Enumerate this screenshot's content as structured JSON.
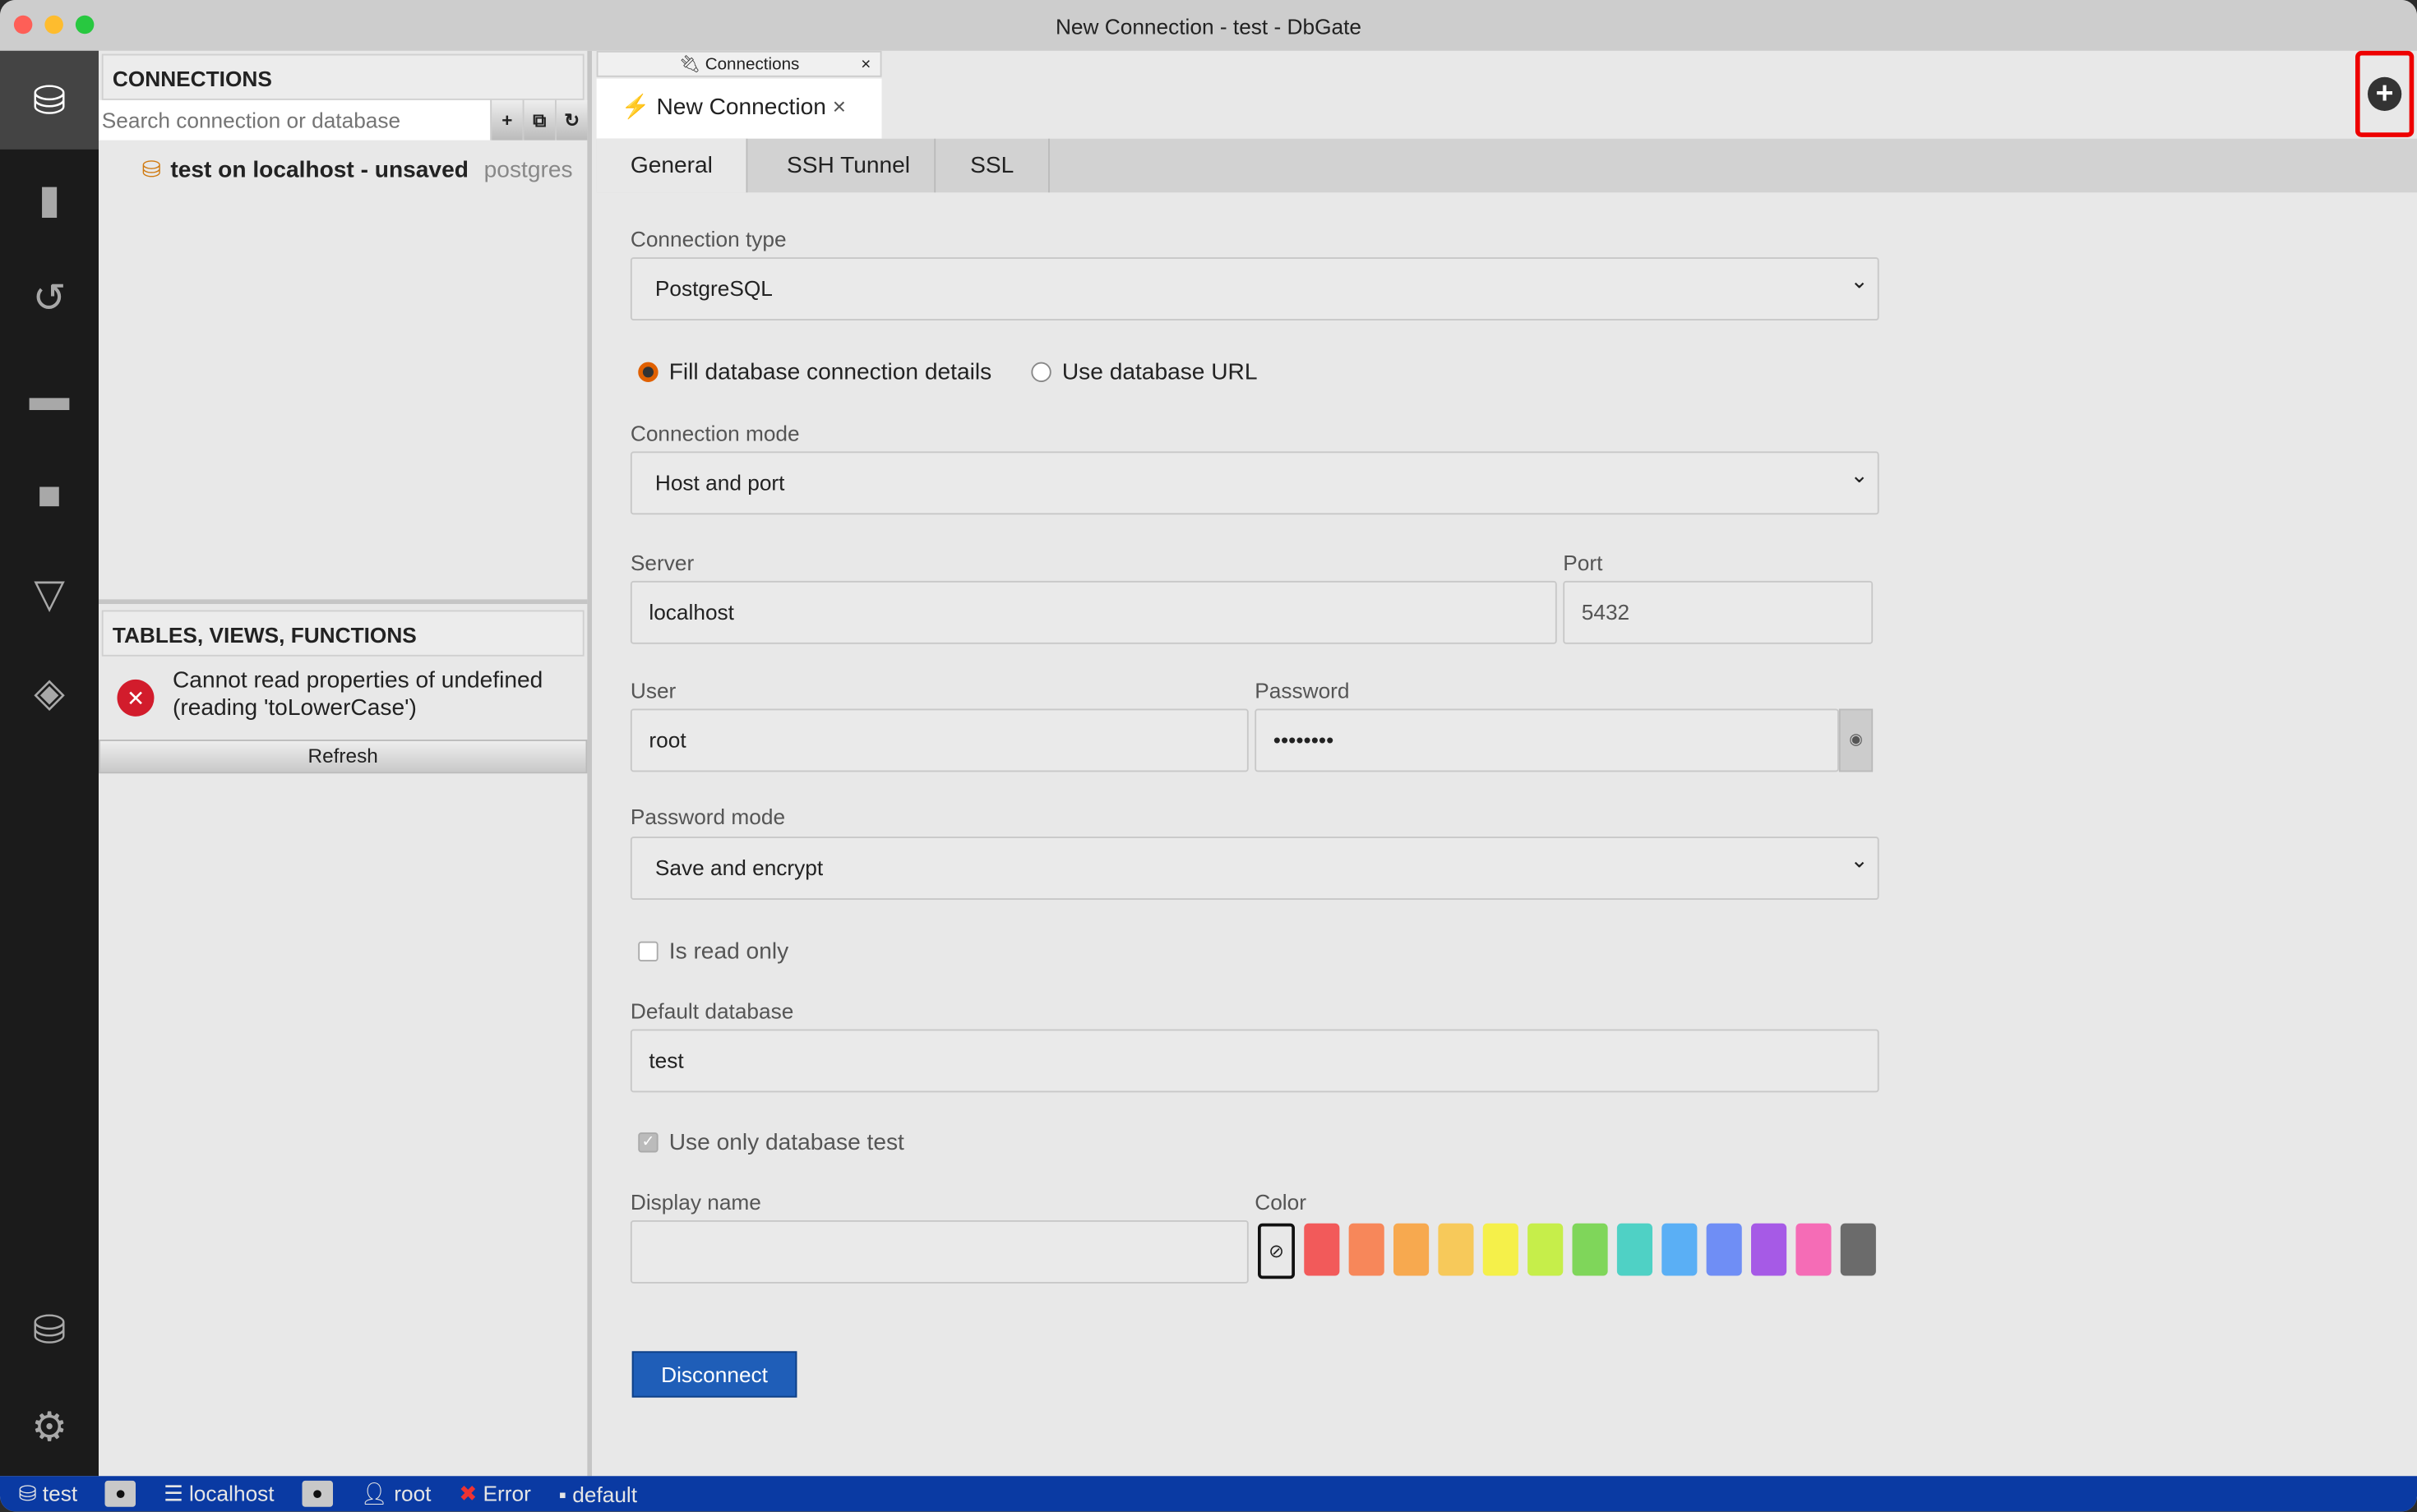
{
  "window": {
    "title": "New Connection - test - DbGate"
  },
  "activity_bar": {
    "icons": [
      "database-icon",
      "file-icon",
      "history-icon",
      "archive-icon",
      "plugin-icon",
      "filter-icon",
      "layers-icon",
      "database-eye-icon",
      "gear-icon"
    ]
  },
  "connections_panel": {
    "title": "CONNECTIONS",
    "search_placeholder": "Search connection or database",
    "add": "+",
    "folder": "⧉",
    "refresh": "↻",
    "items": [
      {
        "label": "test on localhost - unsaved",
        "engine": "postgres"
      }
    ]
  },
  "objects_panel": {
    "title": "TABLES, VIEWS, FUNCTIONS",
    "error": "Cannot read properties of undefined (reading 'toLowerCase')",
    "refresh": "Refresh"
  },
  "tabs": [
    {
      "label": "Connections",
      "close": "×"
    },
    {
      "label": "New Connection",
      "close": "×"
    }
  ],
  "subtabs": [
    "General",
    "SSH Tunnel",
    "SSL"
  ],
  "form": {
    "connection_type_label": "Connection type",
    "connection_type": "PostgreSQL",
    "radio_fill": "Fill database connection details",
    "radio_url": "Use database URL",
    "connection_mode_label": "Connection mode",
    "connection_mode": "Host and port",
    "server_label": "Server",
    "server": "localhost",
    "port_label": "Port",
    "port": "5432",
    "user_label": "User",
    "user": "root",
    "password_label": "Password",
    "password": "••••••••",
    "password_mode_label": "Password mode",
    "password_mode": "Save and encrypt",
    "read_only_label": "Is read only",
    "read_only": false,
    "default_db_label": "Default database",
    "default_db": "test",
    "use_only_label": "Use only database test",
    "use_only": true,
    "display_name_label": "Display name",
    "display_name": "",
    "color_label": "Color",
    "colors": [
      "#f25a5a",
      "#f7875a",
      "#f7a94f",
      "#f7c95a",
      "#f5f04a",
      "#c6ee4a",
      "#7fd65a",
      "#4fd1c5",
      "#5aaff5",
      "#6f8ef5",
      "#a65ae6",
      "#f56cb6",
      "#6b6b6b"
    ],
    "disconnect": "Disconnect"
  },
  "status_bar": {
    "db": "test",
    "server": "localhost",
    "user": "root",
    "error": "Error",
    "schema": "default"
  }
}
